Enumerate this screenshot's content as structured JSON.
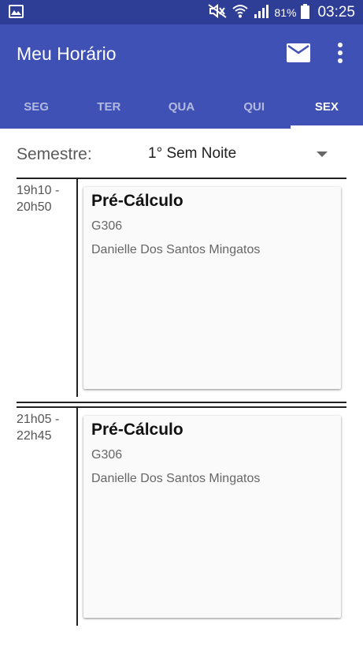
{
  "status_bar": {
    "battery": "81%",
    "time": "03:25"
  },
  "app_bar": {
    "title": "Meu Horário",
    "icons": [
      "mail-icon",
      "more-vert-icon"
    ]
  },
  "tabs": [
    {
      "label": "SEG",
      "active": false
    },
    {
      "label": "TER",
      "active": false
    },
    {
      "label": "QUA",
      "active": false
    },
    {
      "label": "QUI",
      "active": false
    },
    {
      "label": "SEX",
      "active": true
    }
  ],
  "semester": {
    "label": "Semestre:",
    "value": "1° Sem Noite"
  },
  "slots": [
    {
      "time": "19h10 -\n20h50",
      "course": "Pré-Cálculo",
      "room": "G306",
      "teacher": "Danielle Dos Santos Mingatos"
    },
    {
      "time": "21h05 -\n22h45",
      "course": "Pré-Cálculo",
      "room": "G306",
      "teacher": "Danielle Dos Santos Mingatos"
    }
  ],
  "colors": {
    "primary": "#3f51b5",
    "primary_dark": "#2e3e96",
    "card": "#fafafa"
  }
}
